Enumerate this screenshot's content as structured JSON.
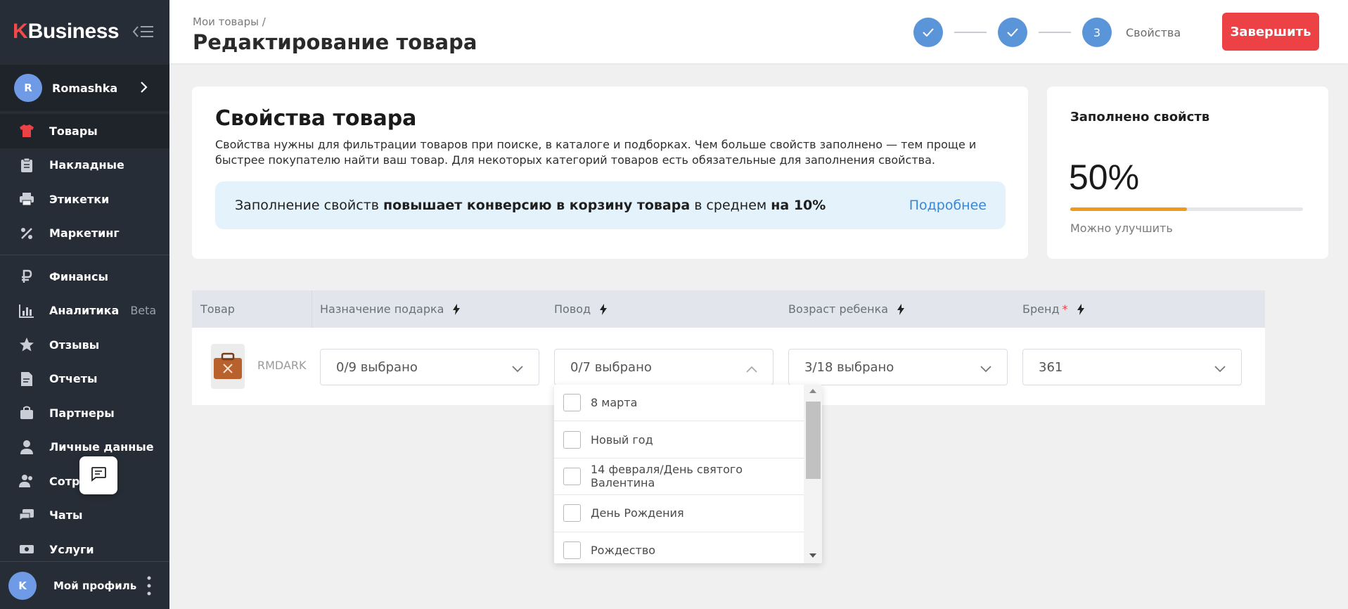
{
  "sidebar": {
    "logo_k": "K",
    "logo_word": "Business",
    "account": {
      "initial": "R",
      "name": "Romashka"
    },
    "items": [
      {
        "label": "Товары",
        "icon": "tshirt-icon"
      },
      {
        "label": "Накладные",
        "icon": "clipboard-icon"
      },
      {
        "label": "Этикетки",
        "icon": "printer-icon"
      },
      {
        "label": "Маркетинг",
        "icon": "percent-icon"
      },
      {
        "label": "Финансы",
        "icon": "ruble-icon"
      },
      {
        "label": "Аналитика",
        "icon": "bar-chart-icon",
        "badge": "Beta"
      },
      {
        "label": "Отзывы",
        "icon": "star-icon"
      },
      {
        "label": "Отчеты",
        "icon": "document-icon"
      },
      {
        "label": "Партнеры",
        "icon": "briefcase-icon"
      },
      {
        "label": "Личные данные",
        "icon": "person-icon"
      },
      {
        "label": "Сотру",
        "icon": "people-icon"
      },
      {
        "label": "Чаты",
        "icon": "chat-icon"
      },
      {
        "label": "Услуги",
        "icon": "money-icon"
      }
    ],
    "footer": {
      "initial": "K",
      "name": "Мой профиль"
    }
  },
  "header": {
    "breadcrumb": "Мои товары /",
    "title": "Редактирование товара",
    "step3_number": "3",
    "step3_label": "Свойства",
    "finish_label": "Завершить"
  },
  "properties": {
    "title": "Свойства товара",
    "description": "Свойства нужны для фильтрации товаров при поиске, в каталоге и подборках. Чем больше свойств заполнено — тем проще и быстрее покупателю найти ваш товар. Для некоторых категорий товаров есть обязательные для заполнения свойства.",
    "promo_part1": "Заполнение свойств ",
    "promo_bold1": "повышает конверсию в корзину товара",
    "promo_part2": " в среднем ",
    "promo_bold2": "на 10%",
    "promo_link": "Подробнее"
  },
  "fill": {
    "title": "Заполнено свойств",
    "percent_label": "50%",
    "progress": 0.5,
    "hint": "Можно улучшить"
  },
  "table": {
    "headers": {
      "product": "Товар",
      "purpose": "Назначение подарка",
      "occasion": "Повод",
      "age": "Возраст ребенка",
      "brand": "Бренд",
      "brand_required": "*"
    },
    "row": {
      "product_name": "RMDARK",
      "purpose_value": "0/9 выбрано",
      "occasion_value": "0/7 выбрано",
      "age_value": "3/18 выбрано",
      "brand_value": "361"
    }
  },
  "dropdown": {
    "options": [
      "8 марта",
      "Новый год",
      "14 февраля/День святого Валентина",
      "День Рождения",
      "Рождество"
    ]
  },
  "colors": {
    "accent_red": "#ec4246",
    "step_blue": "#5b95d9",
    "progress_orange": "#f09a1b",
    "link_blue": "#3a86d6"
  }
}
